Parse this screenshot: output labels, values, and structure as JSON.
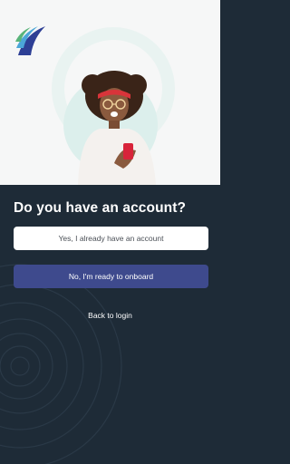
{
  "hero": {
    "logo": "bank-logo-icon",
    "illustration": "woman-with-phone-photo"
  },
  "onboarding": {
    "question": "Do you have an account?",
    "existing_account_label": "Yes, I already have an account",
    "new_account_label": "No, I'm ready to onboard",
    "back_to_login_label": "Back to login"
  },
  "colors": {
    "panel_background": "#1e2b37",
    "primary_button": "#3e4a8d",
    "secondary_button": "#ffffff",
    "hero_background": "#f6f7f7"
  }
}
